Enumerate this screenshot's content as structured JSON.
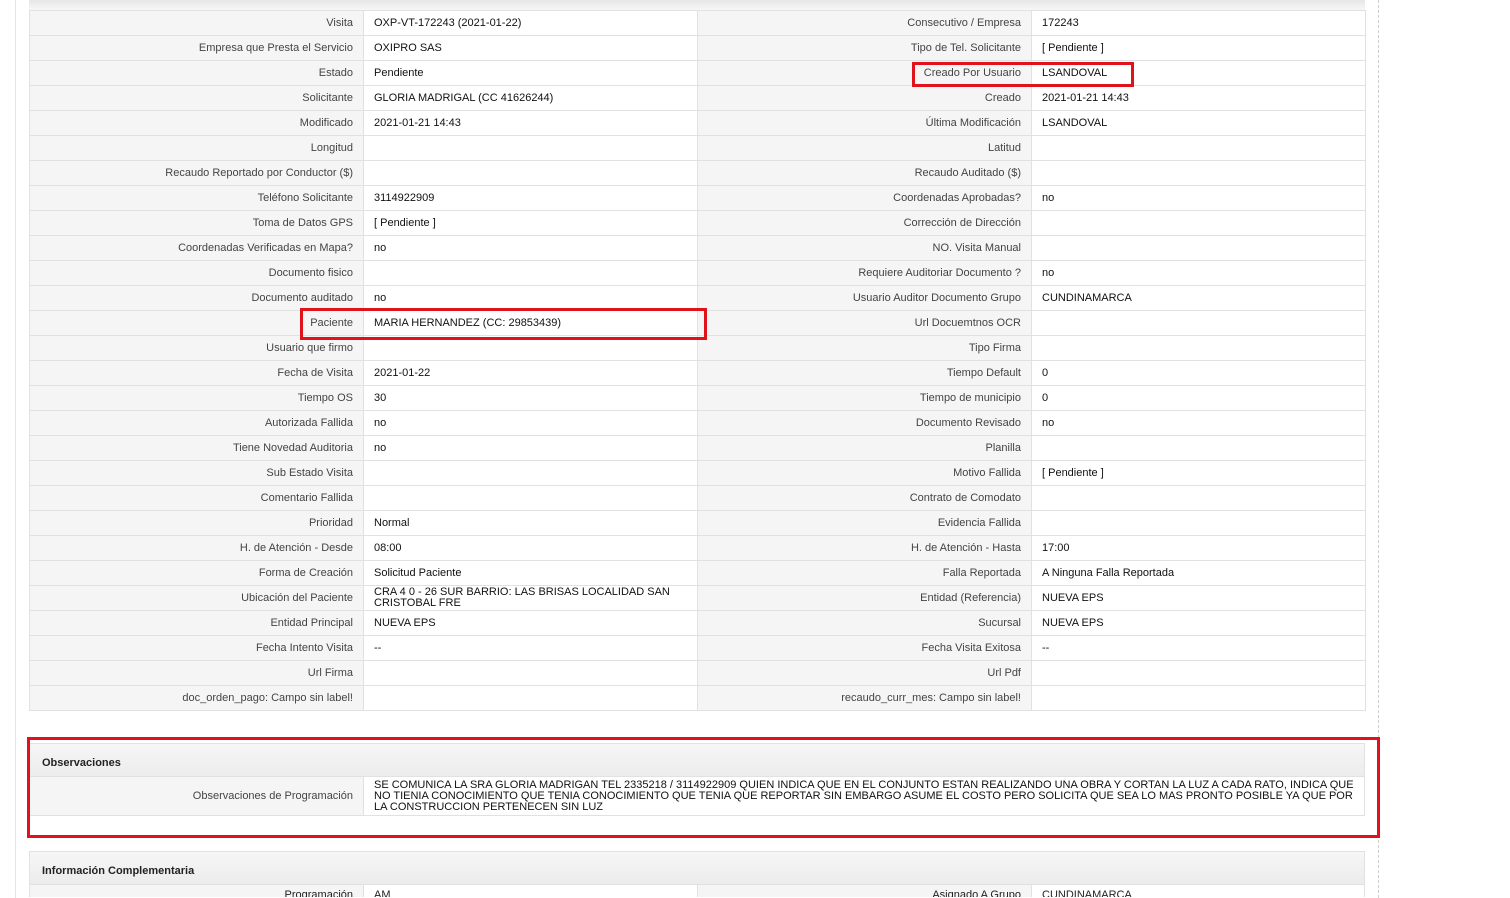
{
  "rows": [
    [
      {
        "label": "Visita",
        "value": "OXP-VT-172243 (2021-01-22)"
      },
      {
        "label": "Consecutivo / Empresa",
        "value": "172243"
      }
    ],
    [
      {
        "label": "Empresa que Presta el Servicio",
        "value": "OXIPRO SAS"
      },
      {
        "label": "Tipo de Tel. Solicitante",
        "value": "[ Pendiente ]"
      }
    ],
    [
      {
        "label": "Estado",
        "value": "Pendiente"
      },
      {
        "label": "Creado Por Usuario",
        "value": "LSANDOVAL"
      }
    ],
    [
      {
        "label": "Solicitante",
        "value": "GLORIA MADRIGAL (CC 41626244)"
      },
      {
        "label": "Creado",
        "value": "2021-01-21 14:43"
      }
    ],
    [
      {
        "label": "Modificado",
        "value": "2021-01-21 14:43"
      },
      {
        "label": "Última Modificación",
        "value": " LSANDOVAL"
      }
    ],
    [
      {
        "label": "Longitud",
        "value": ""
      },
      {
        "label": "Latitud",
        "value": ""
      }
    ],
    [
      {
        "label": "Recaudo Reportado por Conductor ($)",
        "value": ""
      },
      {
        "label": "Recaudo Auditado ($)",
        "value": ""
      }
    ],
    [
      {
        "label": "Teléfono Solicitante",
        "value": "3114922909"
      },
      {
        "label": "Coordenadas Aprobadas?",
        "value": " no"
      }
    ],
    [
      {
        "label": "Toma de Datos GPS",
        "value": "[ Pendiente ]"
      },
      {
        "label": "Corrección de Dirección",
        "value": ""
      }
    ],
    [
      {
        "label": "Coordenadas Verificadas en Mapa?",
        "value": " no"
      },
      {
        "label": "NO. Visita Manual",
        "value": ""
      }
    ],
    [
      {
        "label": "Documento fisico",
        "value": ""
      },
      {
        "label": "Requiere Auditoriar Documento ?",
        "value": " no"
      }
    ],
    [
      {
        "label": "Documento auditado",
        "value": " no"
      },
      {
        "label": "Usuario Auditor Documento Grupo",
        "value": "CUNDINAMARCA"
      }
    ],
    [
      {
        "label": "Paciente",
        "value": "MARIA HERNANDEZ (CC: 29853439)"
      },
      {
        "label": "Url Docuemtnos OCR",
        "value": ""
      }
    ],
    [
      {
        "label": "Usuario que firmo",
        "value": ""
      },
      {
        "label": "Tipo Firma",
        "value": ""
      }
    ],
    [
      {
        "label": "Fecha de Visita",
        "value": " 2021-01-22"
      },
      {
        "label": "Tiempo Default",
        "value": "0"
      }
    ],
    [
      {
        "label": "Tiempo OS",
        "value": "30"
      },
      {
        "label": "Tiempo de municipio",
        "value": "0"
      }
    ],
    [
      {
        "label": "Autorizada Fallida",
        "value": " no"
      },
      {
        "label": "Documento Revisado",
        "value": " no"
      }
    ],
    [
      {
        "label": "Tiene Novedad Auditoria",
        "value": " no"
      },
      {
        "label": "Planilla",
        "value": ""
      }
    ],
    [
      {
        "label": "Sub Estado Visita",
        "value": ""
      },
      {
        "label": "Motivo Fallida",
        "value": "[ Pendiente ]"
      }
    ],
    [
      {
        "label": "Comentario Fallida",
        "value": ""
      },
      {
        "label": "Contrato de Comodato",
        "value": ""
      }
    ],
    [
      {
        "label": "Prioridad",
        "value": "Normal"
      },
      {
        "label": "Evidencia Fallida",
        "value": ""
      }
    ],
    [
      {
        "label": "H. de Atención - Desde",
        "value": "08:00"
      },
      {
        "label": "H. de Atención - Hasta",
        "value": "17:00"
      }
    ],
    [
      {
        "label": "Forma de Creación",
        "value": "Solicitud Paciente"
      },
      {
        "label": "Falla Reportada",
        "value": "A Ninguna Falla Reportada"
      }
    ],
    [
      {
        "label": "Ubicación del Paciente",
        "value": "CRA 4 0 - 26 SUR BARRIO: LAS BRISAS LOCALIDAD SAN CRISTOBAL FRE"
      },
      {
        "label": "Entidad (Referencia)",
        "value": "NUEVA EPS"
      }
    ],
    [
      {
        "label": "Entidad Principal",
        "value": "NUEVA EPS"
      },
      {
        "label": "Sucursal",
        "value": "NUEVA EPS"
      }
    ],
    [
      {
        "label": "Fecha Intento Visita",
        "value": " --"
      },
      {
        "label": "Fecha Visita Exitosa",
        "value": " --"
      }
    ],
    [
      {
        "label": "Url Firma",
        "value": ""
      },
      {
        "label": "Url Pdf",
        "value": ""
      }
    ],
    [
      {
        "label": "doc_orden_pago: Campo sin label!",
        "value": ""
      },
      {
        "label": "recaudo_curr_mes: Campo sin label!",
        "value": ""
      }
    ]
  ],
  "observaciones": {
    "title": "Observaciones",
    "label": "Observaciones de Programación",
    "text": "   SE COMUNICA LA SRA GLORIA MADRIGAN TEL 2335218 / 3114922909 QUIEN INDICA QUE EN EL CONJUNTO ESTAN REALIZANDO UNA OBRA Y CORTAN LA LUZ A CADA RATO, INDICA QUE NO TIENIA CONOCIMIENTO QUE TENIA CONOCIMIENTO QUE TENIA QUE REPORTAR SIN EMBARGO ASUME EL COSTO PERO SOLICITA QUE SEA LO MAS PRONTO POSIBLE YA QUE POR LA CONSTRUCCION PERTENECEN SIN LUZ"
  },
  "complementaria": {
    "title": "Información Complementaria",
    "partial_row": {
      "label1": "Programación",
      "value1": "AM",
      "label2": "Asignado A Grupo",
      "value2": "CUNDINAMARCA"
    }
  },
  "colors": {
    "highlight": "#e0121b",
    "label_bg": "#f5f5f5",
    "border": "#e1e1e1"
  }
}
